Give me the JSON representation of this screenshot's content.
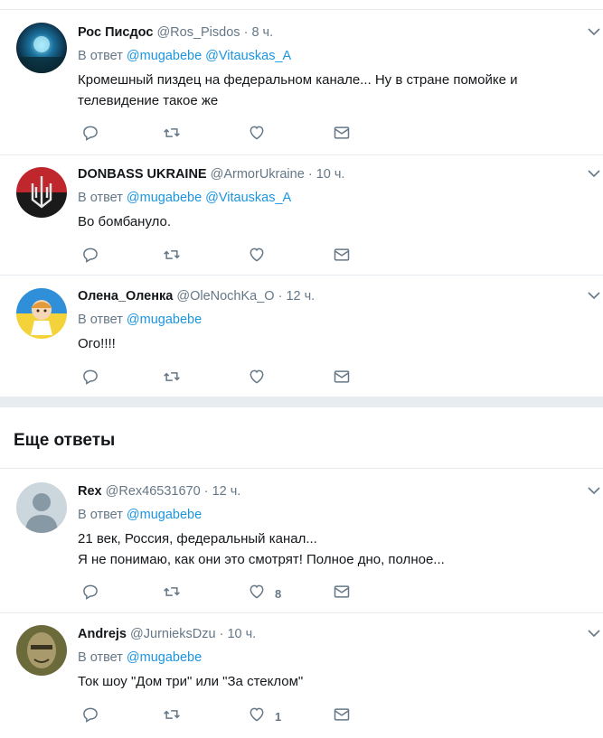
{
  "section_title": "Еще ответы",
  "tweets": [
    {
      "name": "Рос Писдос",
      "handle": "@Ros_Pisdos",
      "separator": "·",
      "time": "8 ч.",
      "reply_prefix": "В ответ",
      "mentions": [
        "@mugabebe",
        "@Vitauskas_A"
      ],
      "text_lines": [
        "Кромешный пиздец на федеральном канале... Ну в стране помойке и",
        "телевидение такое же"
      ],
      "like_count": ""
    },
    {
      "name": "DONBASS UKRAINE",
      "handle": "@ArmorUkraine",
      "separator": "·",
      "time": "10 ч.",
      "reply_prefix": "В ответ",
      "mentions": [
        "@mugabebe",
        "@Vitauskas_A"
      ],
      "text_lines": [
        "Во  бомбануло."
      ],
      "like_count": ""
    },
    {
      "name": "Олена_Оленка",
      "handle": "@OleNochKa_O",
      "separator": "·",
      "time": "12 ч.",
      "reply_prefix": "В ответ",
      "mentions": [
        "@mugabebe"
      ],
      "text_lines": [
        "Ого!!!!"
      ],
      "like_count": ""
    },
    {
      "name": "Rex",
      "handle": "@Rex46531670",
      "separator": "·",
      "time": "12 ч.",
      "reply_prefix": "В ответ",
      "mentions": [
        "@mugabebe"
      ],
      "text_lines": [
        "21 век, Россия, федеральный канал...",
        "Я не понимаю, как они это смотрят! Полное дно, полное..."
      ],
      "like_count": "8"
    },
    {
      "name": "Andrejs",
      "handle": "@JurnieksDzu",
      "separator": "·",
      "time": "10 ч.",
      "reply_prefix": "В ответ",
      "mentions": [
        "@mugabebe"
      ],
      "text_lines": [
        "Ток шоу \"Дом три\" или \"За стеклом\""
      ],
      "like_count": "1"
    }
  ],
  "icons": {
    "reply": "reply-icon",
    "retweet": "retweet-icon",
    "like": "heart-icon",
    "dm": "envelope-icon",
    "more": "chevron-down-icon"
  },
  "colors": {
    "link": "#1b95e0",
    "secondary": "#657786",
    "border": "#e6ecf0",
    "text": "#14171a"
  }
}
